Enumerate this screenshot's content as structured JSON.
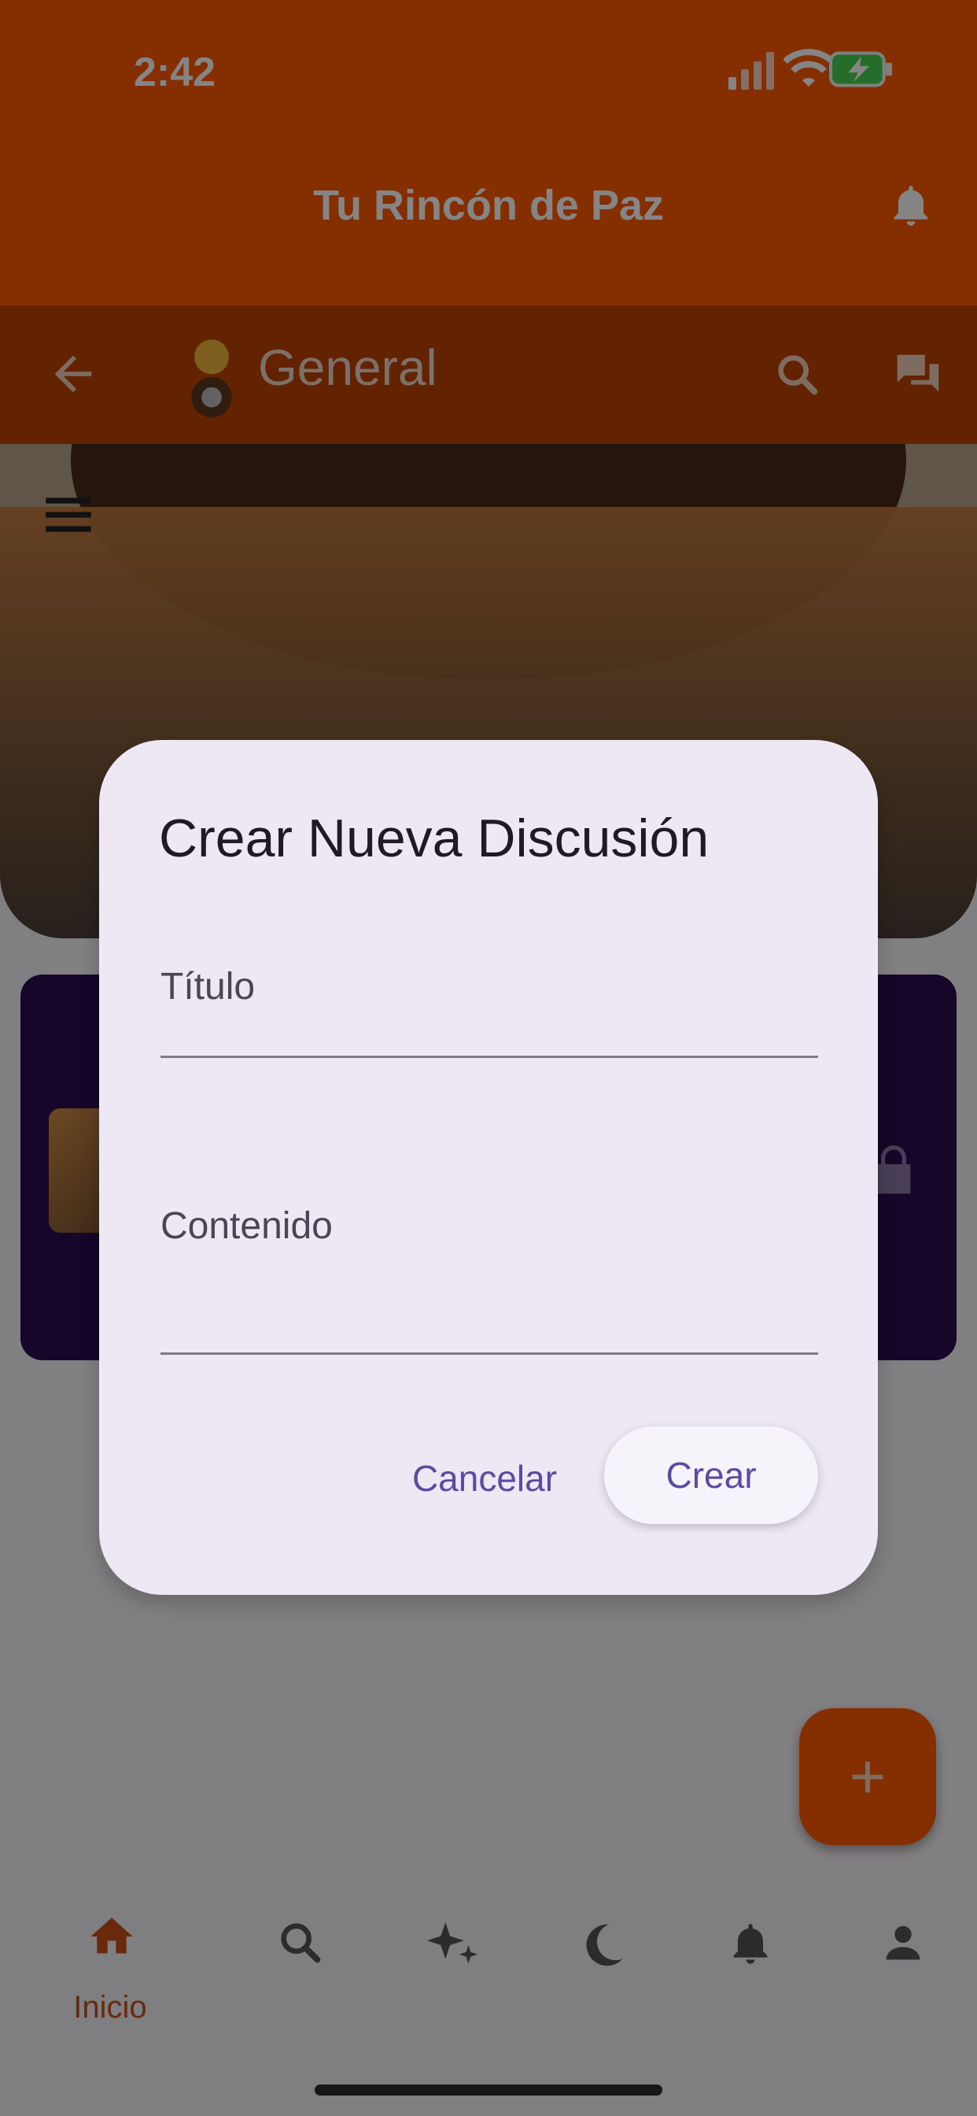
{
  "status_bar": {
    "time": "2:42"
  },
  "app_bar": {
    "title": "Tu Rincón de Paz"
  },
  "toolbar": {
    "title": "General"
  },
  "dialog": {
    "heading": "Crear Nueva Discusión",
    "fields": [
      {
        "label": "Título"
      },
      {
        "label": "Contenido"
      }
    ],
    "buttons": {
      "cancel": "Cancelar",
      "create": "Crear"
    }
  },
  "bottom_nav": {
    "home_label": "Inicio"
  },
  "fab": {
    "icon": "plus-icon"
  },
  "colors": {
    "primary_orange": "#ff5a00",
    "accent_purple": "#5c4ba3",
    "card_bg": "#2b0c4f"
  }
}
